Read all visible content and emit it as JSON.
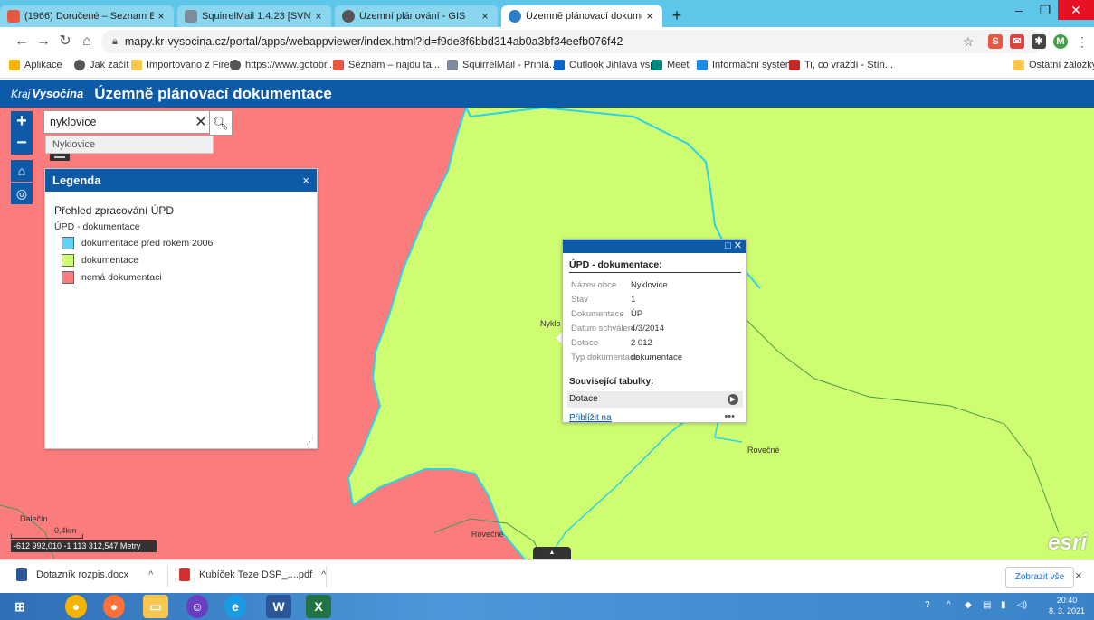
{
  "browser": {
    "tabs": [
      {
        "title": "(1966) Doručené – Seznam Email",
        "icon": "seznam-icon",
        "close": "×"
      },
      {
        "title": "SquirrelMail 1.4.23 [SVN]",
        "icon": "squirrelmail-icon",
        "close": "×"
      },
      {
        "title": "Územní plánování - GIS",
        "icon": "globe-icon",
        "close": "×"
      },
      {
        "title": "Územně plánovací dokumentace",
        "icon": "arcgis-icon",
        "close": "×"
      }
    ],
    "new_tab": "+",
    "url": "mapy.kr-vysocina.cz/portal/apps/webappviewer/index.html?id=f9de8f6bbd314ab0a3bf34eefb076f42",
    "profile_initial": "M",
    "bookmarks": [
      "Aplikace",
      "Jak začít",
      "Importováno z Firef...",
      "https://www.gotobr...",
      "Seznam – najdu ta...",
      "SquirrelMail - Přihlá...",
      "Outlook Jihlava vspji",
      "Meet",
      "Informační systém",
      "Ti, co vraždí - Stín..."
    ],
    "other_bookmarks": "Ostatní záložky"
  },
  "app": {
    "logo_text": "Kraj",
    "logo_brand": "Vysočina",
    "title": "Územně plánovací dokumentace"
  },
  "search": {
    "value": "nyklovice",
    "suggestion": "Nyklovice"
  },
  "legend": {
    "title": "Legenda",
    "close": "×",
    "layer_title": "Přehled zpracování ÚPD",
    "sublayer": "ÚPD - dokumentace",
    "items": [
      {
        "label": "dokumentace před rokem 2006",
        "color": "#5fd3f5"
      },
      {
        "label": "dokumentace",
        "color": "#cffd71"
      },
      {
        "label": "nemá dokumentaci",
        "color": "#fb7c7c"
      }
    ]
  },
  "popup": {
    "title": "ÚPD - dokumentace:",
    "fields": [
      {
        "label": "Název obce",
        "value": "Nyklovice"
      },
      {
        "label": "Stav",
        "value": "1"
      },
      {
        "label": "Dokumentace",
        "value": "ÚP"
      },
      {
        "label": "Datum schválení",
        "value": "4/3/2014"
      },
      {
        "label": "Dotace",
        "value": "2 012"
      },
      {
        "label": "Typ dokumentace",
        "value": "dokumentace"
      }
    ],
    "related_title": "Související tabulky:",
    "related_item": "Dotace",
    "zoom_link": "Přiblížit na",
    "more": "•••"
  },
  "map": {
    "labels": [
      "Nyklo",
      "Rovečné",
      "Rovečné",
      "Dalečín"
    ],
    "scale_label": "0,4km",
    "coordinates": "-612 992,010 -1 113 312,547 Metry",
    "esri": "esri",
    "colors": {
      "documented": "#cffd71",
      "none": "#fb7c7c",
      "boundary": "#2ad4e6"
    }
  },
  "downloads": {
    "items": [
      "Dotazník rozpis.docx",
      "Kubíček Teze DSP_....pdf"
    ],
    "show_all": "Zobrazit vše",
    "close": "×"
  },
  "taskbar": {
    "time": "20:40",
    "date": "8. 3. 2021"
  }
}
